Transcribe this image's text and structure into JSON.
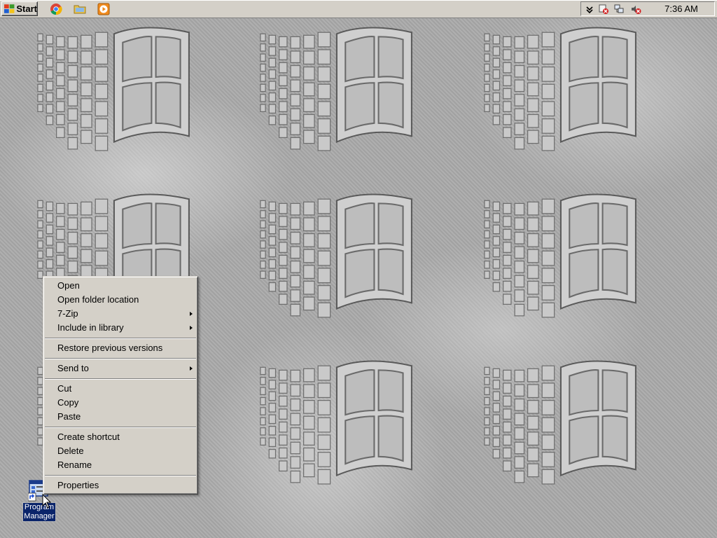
{
  "taskbar": {
    "start_label": "Start",
    "quick_launch": [
      {
        "icon": "chrome-icon"
      },
      {
        "icon": "folder-icon"
      },
      {
        "icon": "media-player-icon"
      }
    ],
    "tray": {
      "icons": [
        "show-hidden-icons-chevron",
        "network-error-icon",
        "network-icon",
        "volume-muted-icon"
      ],
      "clock": "7:36 AM"
    }
  },
  "desktop": {
    "icons": [
      {
        "label": "Program Manager",
        "line1": "Program",
        "line2": "Manager"
      }
    ]
  },
  "context_menu": {
    "items": [
      {
        "label": "Open",
        "submenu": false
      },
      {
        "label": "Open folder location",
        "submenu": false
      },
      {
        "label": "7-Zip",
        "submenu": true
      },
      {
        "label": "Include in library",
        "submenu": true
      },
      {
        "separator": true
      },
      {
        "label": "Restore previous versions",
        "submenu": false
      },
      {
        "separator": true
      },
      {
        "label": "Send to",
        "submenu": true
      },
      {
        "separator": true
      },
      {
        "label": "Cut",
        "submenu": false
      },
      {
        "label": "Copy",
        "submenu": false
      },
      {
        "label": "Paste",
        "submenu": false
      },
      {
        "separator": true
      },
      {
        "label": "Create shortcut",
        "submenu": false
      },
      {
        "label": "Delete",
        "submenu": false
      },
      {
        "label": "Rename",
        "submenu": false
      },
      {
        "separator": true
      },
      {
        "label": "Properties",
        "submenu": false
      }
    ]
  },
  "colors": {
    "taskbar": "#d4d0c8",
    "selection": "#0a246a",
    "wallpaper": "#aaaaaa"
  }
}
